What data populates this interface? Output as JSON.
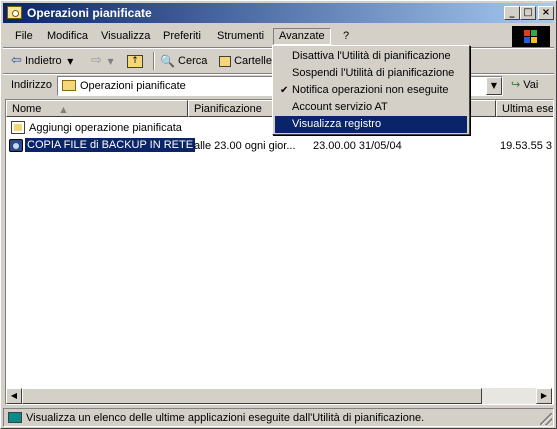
{
  "window": {
    "title": "Operazioni pianificate",
    "controls": [
      "_",
      "□",
      "×"
    ]
  },
  "menubar": {
    "items": [
      "File",
      "Modifica",
      "Visualizza",
      "Preferiti",
      "Strumenti",
      "Avanzate",
      "?"
    ],
    "open_menu": "Avanzate"
  },
  "toolbar": {
    "back_label": "Indietro",
    "search_label": "Cerca",
    "folders_label": "Cartelle"
  },
  "addressbar": {
    "label": "Indirizzo",
    "value": "Operazioni pianificate",
    "go_label": "Vai"
  },
  "columns": [
    "Nome",
    "Pianificazione",
    "Ultima esec"
  ],
  "rows": [
    {
      "name": "Aggiungi operazione pianificata",
      "schedule": "",
      "next": "",
      "last": ""
    },
    {
      "name": "COPIA FILE di BACKUP IN RETE",
      "schedule": "alle 23.00 ogni gior...",
      "next": "23.00.00  31/05/04",
      "last": "19.53.55  3"
    }
  ],
  "dropdown": {
    "items": [
      {
        "label": "Disattiva l'Utilità di pianificazione",
        "checked": false,
        "highlighted": false
      },
      {
        "label": "Sospendi l'Utilità di pianificazione",
        "checked": false,
        "highlighted": false
      },
      {
        "label": "Notifica operazioni non eseguite",
        "checked": true,
        "highlighted": false
      },
      {
        "label": "Account servizio AT",
        "checked": false,
        "highlighted": false
      },
      {
        "label": "Visualizza registro",
        "checked": false,
        "highlighted": true
      }
    ],
    "check_glyph": "✔"
  },
  "statusbar": {
    "text": "Visualizza un elenco delle ultime applicazioni eseguite dall'Utilità di pianificazione."
  },
  "colors": {
    "title_start": "#0a246a",
    "title_end": "#a6caf0",
    "highlight": "#0a246a",
    "face": "#d4d0c8"
  },
  "icons": [
    "folder-icon",
    "back-arrow-icon",
    "forward-arrow-icon",
    "up-folder-icon",
    "search-icon",
    "folders-icon",
    "go-arrow-icon",
    "task-icon",
    "add-task-icon",
    "windows-logo-icon",
    "check-icon"
  ]
}
